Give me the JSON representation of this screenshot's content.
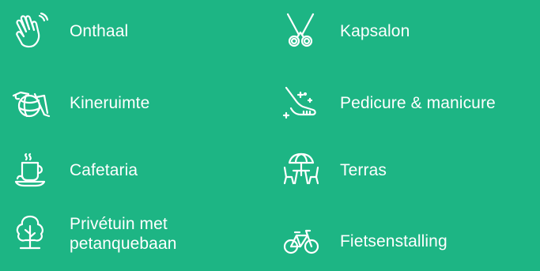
{
  "colors": {
    "background": "#1db584",
    "foreground": "#ffffff"
  },
  "facilities": {
    "left": [
      {
        "icon": "waving-hand-icon",
        "label": "Onthaal"
      },
      {
        "icon": "exercise-ball-icon",
        "label": "Kineruimte"
      },
      {
        "icon": "coffee-cup-icon",
        "label": "Cafetaria"
      },
      {
        "icon": "tree-icon",
        "label": "Privétuin met petanquebaan"
      }
    ],
    "right": [
      {
        "icon": "scissors-icon",
        "label": "Kapsalon"
      },
      {
        "icon": "foot-care-icon",
        "label": "Pedicure & manicure"
      },
      {
        "icon": "terrace-table-umbrella-icon",
        "label": "Terras"
      },
      {
        "icon": "bicycle-icon",
        "label": "Fietsenstalling"
      }
    ]
  }
}
